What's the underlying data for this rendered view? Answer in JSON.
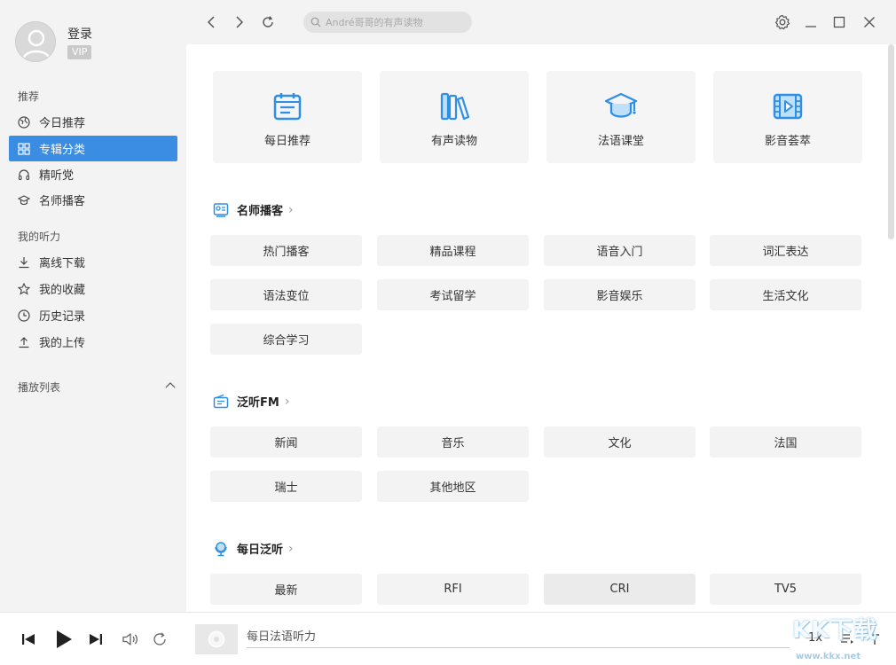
{
  "user": {
    "login": "登录",
    "vip": "VIP"
  },
  "sidebar": {
    "section_recommend": "推荐",
    "items": [
      {
        "label": "今日推荐",
        "icon": "globe-icon"
      },
      {
        "label": "专辑分类",
        "icon": "grid-icon",
        "active": true
      },
      {
        "label": "精听党",
        "icon": "headphones-icon"
      },
      {
        "label": "名师播客",
        "icon": "graduation-cap-icon"
      }
    ],
    "section_mine": "我的听力",
    "mine_items": [
      {
        "label": "离线下载",
        "icon": "download-icon"
      },
      {
        "label": "我的收藏",
        "icon": "star-icon"
      },
      {
        "label": "历史记录",
        "icon": "clock-icon"
      },
      {
        "label": "我的上传",
        "icon": "upload-icon"
      }
    ],
    "section_playlist": "播放列表"
  },
  "topbar": {
    "search_placeholder": "André哥哥的有声读物"
  },
  "main": {
    "cards": [
      {
        "label": "每日推荐",
        "icon": "calendar-list-icon"
      },
      {
        "label": "有声读物",
        "icon": "books-icon"
      },
      {
        "label": "法语课堂",
        "icon": "graduation-cap-icon"
      },
      {
        "label": "影音荟萃",
        "icon": "film-play-icon"
      }
    ],
    "sections": [
      {
        "title": "名师播客",
        "icon": "podcast-list-icon",
        "tags": [
          "热门播客",
          "精品课程",
          "语音入门",
          "词汇表达",
          "语法变位",
          "考试留学",
          "影音娱乐",
          "生活文化",
          "综合学习"
        ]
      },
      {
        "title": "泛听FM",
        "icon": "radio-icon",
        "tags": [
          "新闻",
          "音乐",
          "文化",
          "法国",
          "瑞士",
          "其他地区"
        ]
      },
      {
        "title": "每日泛听",
        "icon": "globe-stand-icon",
        "tags": [
          "最新",
          "RFI",
          "CRI",
          "TV5"
        ]
      }
    ]
  },
  "player": {
    "track": "每日法语听力",
    "speed": "1x"
  },
  "watermark": {
    "brand": "KK下载",
    "url": "www.kkx.net"
  },
  "colors": {
    "accent": "#3a8de3",
    "sidebar_bg": "#f3f3f3",
    "icon_blue": "#2f8fe6"
  }
}
